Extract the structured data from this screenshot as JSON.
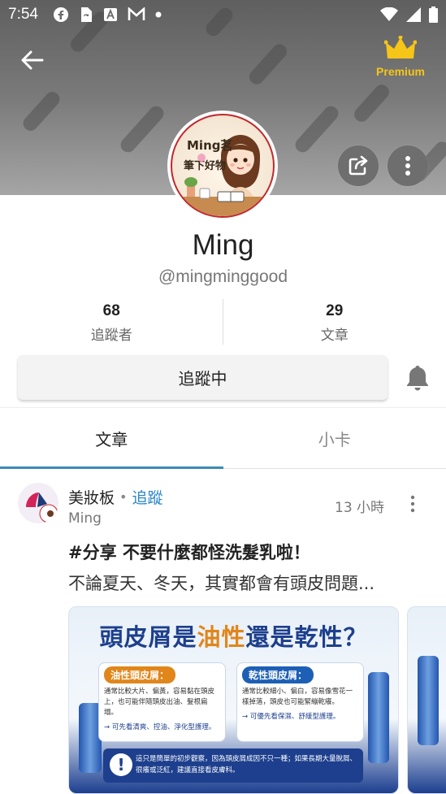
{
  "status_bar": {
    "time": "7:54",
    "icons": [
      "facebook-icon",
      "sync-icon",
      "font-icon",
      "mail-icon",
      "dot-icon"
    ],
    "right_icons": [
      "wifi-icon",
      "signal-icon",
      "battery-icon"
    ]
  },
  "header": {
    "premium_label": "Premium"
  },
  "profile": {
    "name": "Ming",
    "handle": "@mingminggood",
    "avatar_text_1": "Ming",
    "avatar_text_2": "茗",
    "avatar_text_3": "筆下好物"
  },
  "stats": [
    {
      "value": "68",
      "label": "追蹤者"
    },
    {
      "value": "29",
      "label": "文章"
    }
  ],
  "follow_button": "追蹤中",
  "tabs": [
    {
      "label": "文章",
      "active": true
    },
    {
      "label": "小卡",
      "active": false
    }
  ],
  "post": {
    "board": "美妝板",
    "separator": "•",
    "follow": "追蹤",
    "author": "Ming",
    "time": "13 小時",
    "title": "#分享 不要什麼都怪洗髮乳啦！",
    "excerpt": "不論夏天、冬天，其實都會有頭皮問題...",
    "image": {
      "title_a": "頭皮屑是",
      "title_hl": "油性",
      "title_b": "還是乾性？",
      "card1_head": "油性頭皮屑：",
      "card1_body": "通常比較大片、偏黃，容易黏在頭皮上，也可能伴隨頭皮出油、髮根扁塌。",
      "card1_foot": "→ 可先看清爽、控油、淨化型護理。",
      "card2_head": "乾性頭皮屑：",
      "card2_body": "通常比較細小、偏白，容易像雪花一樣掉落，頭皮也可能緊繃乾癢。",
      "card2_foot": "→ 可優先看保濕、舒緩型護理。",
      "note": "這只是簡單的初步觀察，因為頭皮屑成因不只一種；如果長期大量脫屑、很癢或泛紅，建議直接看皮膚科。",
      "note_icon": "!",
      "card1_color": "#e0861b",
      "card2_color": "#1d5fb5"
    }
  },
  "colors": {
    "accent": "#3b8bb8",
    "link": "#2a86c8",
    "premium": "#f5c518"
  }
}
